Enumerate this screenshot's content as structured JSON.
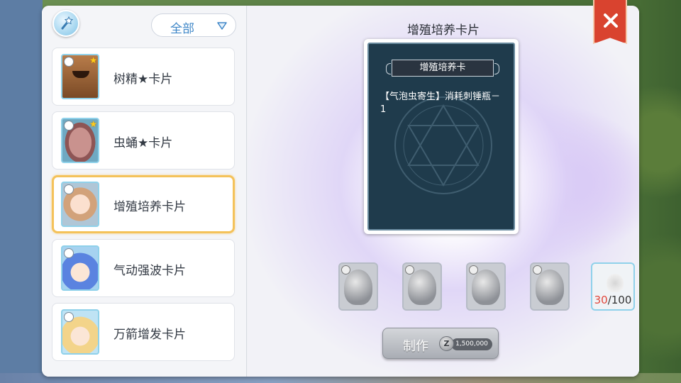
{
  "colors": {
    "accent_blue": "#3e86c7",
    "selected_border": "#f4c25a",
    "card_bg": "#1f3b4c",
    "close_red": "#d9432f",
    "count_have": "#e1473b"
  },
  "toolbar": {
    "wand_icon": "magic-wand-icon",
    "filter_value": "全部",
    "filter_icon": "chevron-down-icon"
  },
  "card_list": [
    {
      "name": "树精★卡片",
      "portrait": "tree-spirit"
    },
    {
      "name": "虫蛹★卡片",
      "portrait": "cocoon"
    },
    {
      "name": "增殖培养卡片",
      "portrait": "girl-with-glasses",
      "selected": true
    },
    {
      "name": "气动强波卡片",
      "portrait": "blue-hair-boy"
    },
    {
      "name": "万箭增发卡片",
      "portrait": "blonde-girl"
    }
  ],
  "detail": {
    "title": "增殖培养卡片",
    "card_banner": "增殖培养卡",
    "card_effect": "【气泡虫寄生】消耗刺锤瓶－1"
  },
  "materials": [
    {
      "name": "ox-statue",
      "locked": true
    },
    {
      "name": "helmeted-creature",
      "locked": true
    },
    {
      "name": "wolf",
      "locked": true
    },
    {
      "name": "cannon",
      "locked": true
    },
    {
      "name": "essence",
      "have": "30",
      "need": "/100"
    }
  ],
  "craft": {
    "label": "制作",
    "currency_icon": "zeny-coin-icon",
    "currency_symbol": "Z",
    "cost": "1,500,000"
  },
  "close": {
    "icon": "close-icon"
  }
}
